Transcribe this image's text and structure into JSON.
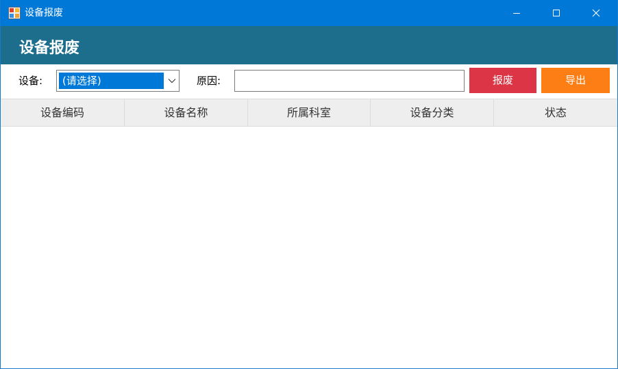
{
  "window": {
    "title": "设备报废",
    "controls": {
      "minimize_icon": "minimize-icon",
      "maximize_icon": "maximize-icon",
      "close_icon": "close-icon"
    }
  },
  "header": {
    "title": "设备报废",
    "background": "#1c6e8c"
  },
  "toolbar": {
    "device_label": "设备:",
    "device_selected": "(请选择)",
    "reason_label": "原因:",
    "reason_value": "",
    "scrap_label": "报废",
    "export_label": "导出"
  },
  "colors": {
    "titlebar": "#0078d7",
    "scrap_button": "#dc3545",
    "export_button": "#fd7e14"
  },
  "grid": {
    "columns": [
      "设备编码",
      "设备名称",
      "所属科室",
      "设备分类",
      "状态"
    ],
    "rows": []
  }
}
